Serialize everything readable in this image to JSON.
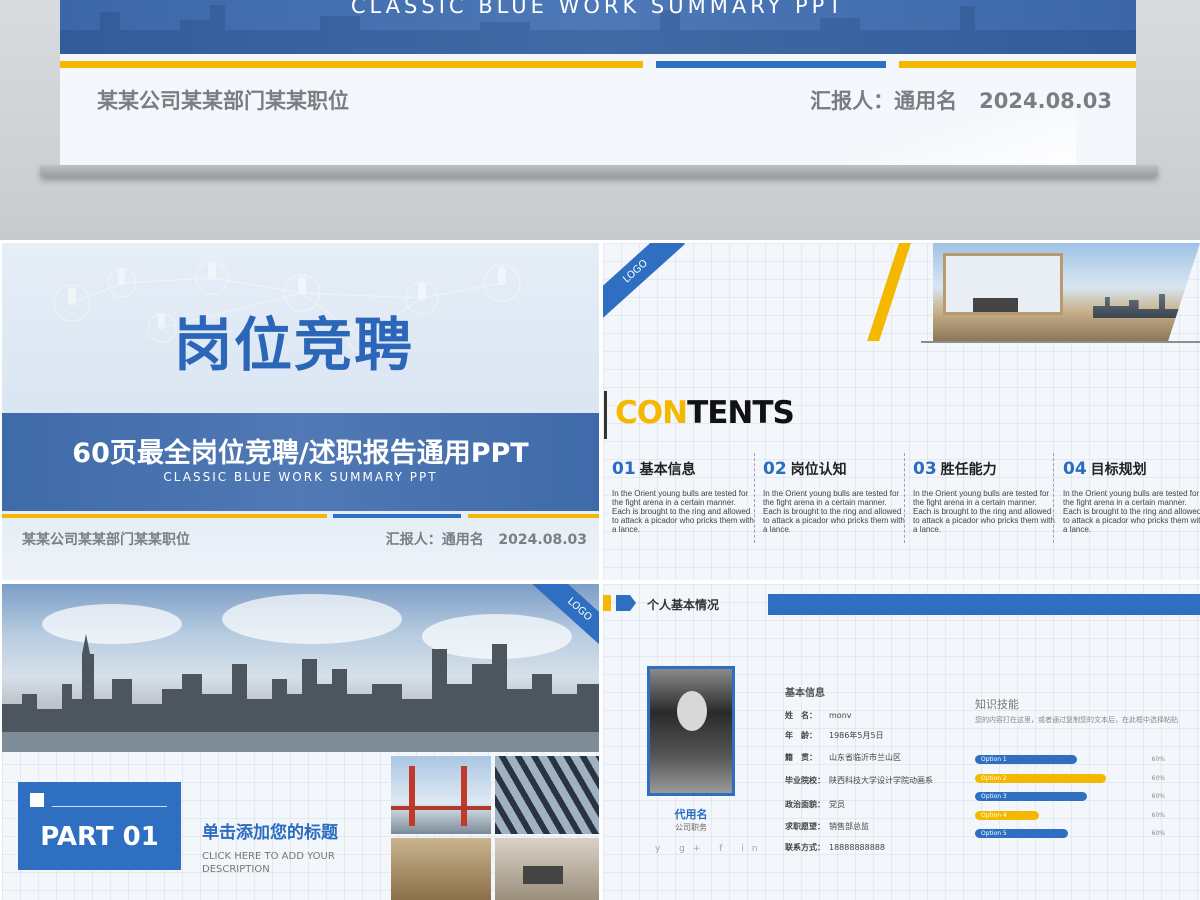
{
  "top_preview": {
    "title_en": "CLASSIC BLUE WORK SUMMARY PPT",
    "company": "某某公司某某部门某某职位",
    "reporter": "汇报人：通用名",
    "date": "2024.08.03"
  },
  "slide_cover": {
    "title": "岗位竞聘",
    "band_title": "60页最全岗位竞聘/述职报告通用PPT",
    "band_en": "CLASSIC BLUE WORK SUMMARY PPT",
    "company": "某某公司某某部门某某职位",
    "reporter": "汇报人：通用名",
    "date": "2024.08.03"
  },
  "slide_contents": {
    "logo": "LOGO",
    "title_highlight": "CON",
    "title_rest": "TENTS",
    "items": [
      {
        "num": "01",
        "label": "基本信息",
        "desc": "In the Orient young bulls are tested for the fight arena in a certain manner. Each is brought to the ring and allowed to attack a picador who pricks them with a lance."
      },
      {
        "num": "02",
        "label": "岗位认知",
        "desc": "In the Orient young bulls are tested for the fight arena in a certain manner. Each is brought to the ring and allowed to attack a picador who pricks them with a lance."
      },
      {
        "num": "03",
        "label": "胜任能力",
        "desc": "In the Orient young bulls are tested for the fight arena in a certain manner. Each is brought to the ring and allowed to attack a picador who pricks them with a lance."
      },
      {
        "num": "04",
        "label": "目标规划",
        "desc": "In the Orient young bulls are tested for the fight arena in a certain manner. Each is brought to the ring and allowed to attack a picador who pricks them with a lance."
      }
    ]
  },
  "slide_part": {
    "logo": "LOGO",
    "part": "PART 01",
    "title": "单击添加您的标题",
    "subtitle": "CLICK HERE TO ADD YOUR DESCRIPTION"
  },
  "slide_profile": {
    "header": "个人基本情况",
    "name": "代用名",
    "job": "公司职务",
    "social": "y  g+  f  in",
    "info_title": "基本信息",
    "info": [
      {
        "key": "姓　名：",
        "value": "monv"
      },
      {
        "key": "年　龄：",
        "value": "1986年5月5日"
      },
      {
        "key": "籍　贯：",
        "value": "山东省临沂市兰山区"
      },
      {
        "key": "毕业院校：",
        "value": "陕西科技大学设计学院动画系"
      },
      {
        "key": "政治面貌：",
        "value": "党员"
      },
      {
        "key": "求职愿望：",
        "value": "销售部总监"
      },
      {
        "key": "联系方式：",
        "value": "18888888888"
      }
    ],
    "skill_title": "知识技能",
    "skill_desc": "您的内容打在这里，或者通过复制您的文本后，在此框中选择粘贴",
    "skills": [
      {
        "label": "Option 1",
        "percent": "60%",
        "fill": 0.64,
        "color": "#2e6fc1"
      },
      {
        "label": "Option 2",
        "percent": "60%",
        "fill": 0.82,
        "color": "#f5b800"
      },
      {
        "label": "Option 3",
        "percent": "60%",
        "fill": 0.7,
        "color": "#2e6fc1"
      },
      {
        "label": "Option 4",
        "percent": "60%",
        "fill": 0.4,
        "color": "#f5b800"
      },
      {
        "label": "Option 5",
        "percent": "60%",
        "fill": 0.58,
        "color": "#2e6fc1"
      }
    ]
  },
  "colors": {
    "brand_blue": "#2e6fc1",
    "accent_yellow": "#f5b800"
  }
}
